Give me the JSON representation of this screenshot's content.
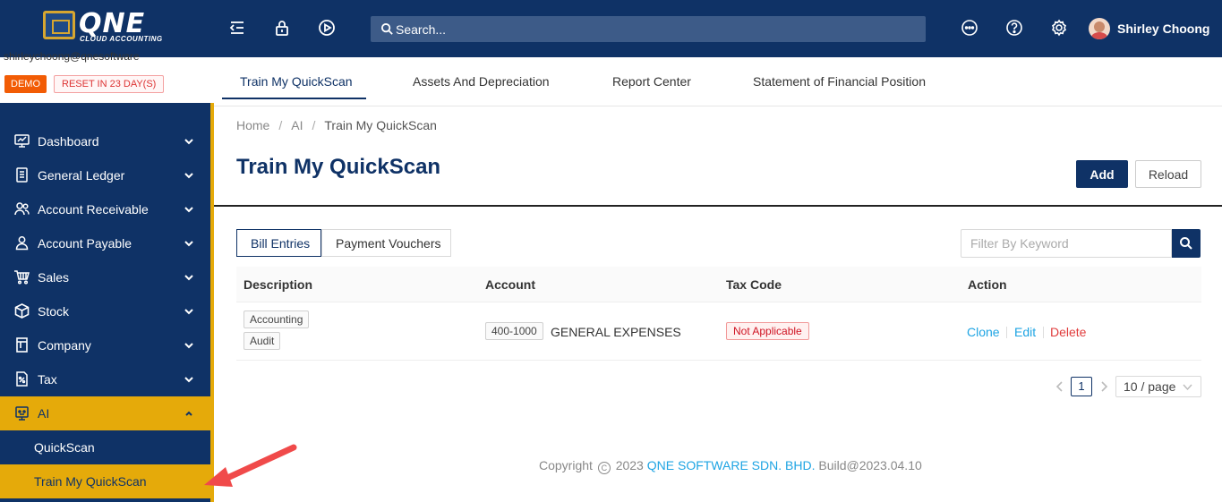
{
  "brand": {
    "name": "QNE",
    "tagline": "CLOUD ACCOUNTING"
  },
  "search": {
    "placeholder": "Search..."
  },
  "user": {
    "name": "Shirley Choong",
    "email": "shirleychoong@qnesoftware"
  },
  "account_badges": {
    "demo": "DEMO",
    "reset": "RESET IN 23 DAY(S)"
  },
  "sidebar": {
    "items": [
      {
        "label": "Dashboard",
        "icon": "monitor-chart-icon"
      },
      {
        "label": "General Ledger",
        "icon": "ledger-icon"
      },
      {
        "label": "Account Receivable",
        "icon": "users-icon"
      },
      {
        "label": "Account Payable",
        "icon": "user-icon"
      },
      {
        "label": "Sales",
        "icon": "cart-icon"
      },
      {
        "label": "Stock",
        "icon": "cube-icon"
      },
      {
        "label": "Company",
        "icon": "building-icon"
      },
      {
        "label": "Tax",
        "icon": "tax-document-icon"
      },
      {
        "label": "AI",
        "icon": "robot-icon"
      }
    ],
    "ai_subitems": [
      "QuickScan",
      "Train My QuickScan"
    ]
  },
  "tabs": [
    "Train My QuickScan",
    "Assets And Depreciation",
    "Report Center",
    "Statement of Financial Position"
  ],
  "breadcrumb": [
    "Home",
    "AI",
    "Train My QuickScan"
  ],
  "page": {
    "title": "Train My QuickScan",
    "add_label": "Add",
    "reload_label": "Reload"
  },
  "subtabs": [
    "Bill Entries",
    "Payment Vouchers"
  ],
  "filter": {
    "placeholder": "Filter By Keyword"
  },
  "table": {
    "headers": [
      "Description",
      "Account",
      "Tax Code",
      "Action"
    ],
    "rows": [
      {
        "description_tags": [
          "Accounting",
          "Audit"
        ],
        "account_code": "400-1000",
        "account_name": "GENERAL EXPENSES",
        "tax_code": "Not Applicable",
        "actions": [
          "Clone",
          "Edit",
          "Delete"
        ]
      }
    ]
  },
  "pagination": {
    "current_page": "1",
    "page_size": "10 / page"
  },
  "footer": {
    "copyright": "Copyright",
    "year": "2023",
    "company": "QNE SOFTWARE SDN. BHD.",
    "build": "Build@2023.04.10"
  },
  "colors": {
    "navy": "#0f3266",
    "gold": "#e5aa0a",
    "link": "#1ea4e3",
    "danger": "#e03c3c",
    "annotation_arrow": "#f04a4a"
  }
}
